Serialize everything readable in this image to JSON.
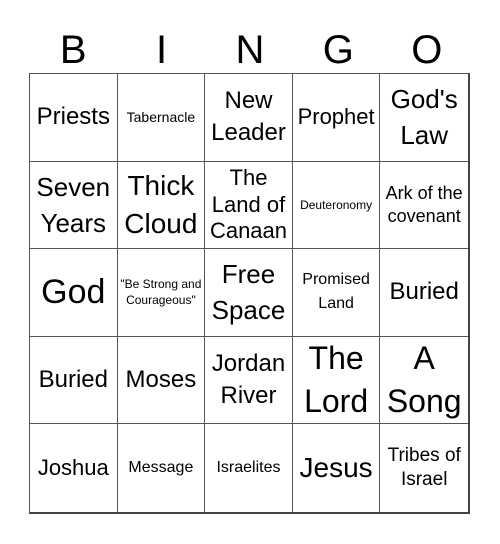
{
  "header": {
    "letters": [
      "B",
      "I",
      "N",
      "G",
      "O"
    ]
  },
  "cells": [
    "Priests",
    "Tabernacle",
    "New Leader",
    "Prophet",
    "God's Law",
    "Seven Years",
    "Thick Cloud",
    "The Land of Canaan",
    "Deuteronomy",
    "Ark of the covenant",
    "God",
    "\"Be Strong and Courageous\"",
    "Free Space",
    "Promised Land",
    "Buried",
    "Buried",
    "Moses",
    "Jordan River",
    "The Lord",
    "A Song",
    "Joshua",
    "Message",
    "Israelites",
    "Jesus",
    "Tribes of Israel"
  ]
}
